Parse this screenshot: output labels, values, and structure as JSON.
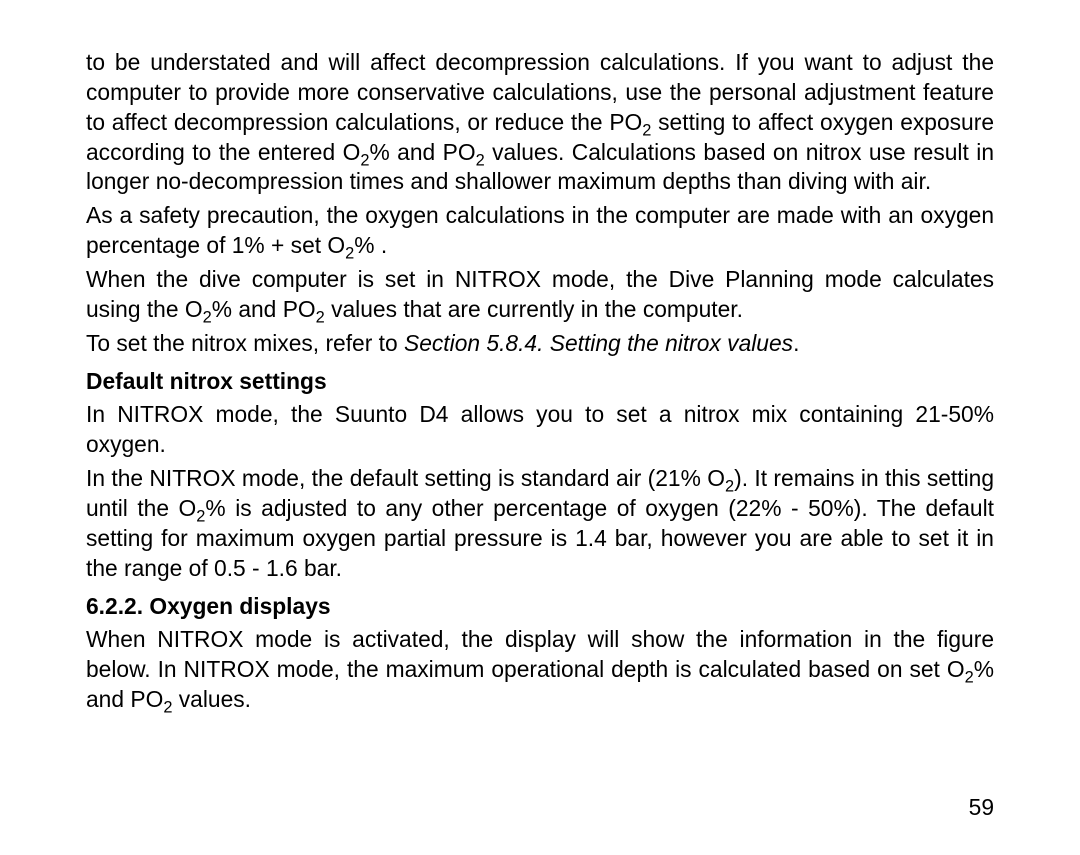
{
  "paragraphs": {
    "p1a": "to be understated and will affect decompression calculations. If you want to adjust the computer to provide more conservative calculations, use the personal adjustment feature to affect decompression calculations, or reduce the PO",
    "p1b": " setting to affect oxygen exposure according to the entered O",
    "p1c": "% and PO",
    "p1d": " values. Calculations based on nitrox use result in longer no-decompression times and shallower maximum depths than diving with air.",
    "p2a": "As a safety precaution, the oxygen calculations in the computer are made with an oxygen percentage of 1% + set O",
    "p2b": "% .",
    "p3a": "When the dive computer is set in NITROX mode, the Dive Planning mode calculates using the O",
    "p3b": "% and PO",
    "p3c": " values that are currently in the computer.",
    "p4a": "To set the nitrox mixes, refer to ",
    "p4b": "Section 5.8.4. Setting the nitrox values",
    "p4c": ".",
    "h1": "Default nitrox settings",
    "p5": "In NITROX mode, the Suunto D4 allows you to set a nitrox mix containing 21-50% oxygen.",
    "p6a": "In the NITROX mode, the default setting is standard air (21% O",
    "p6b": "). It remains in this setting until the O",
    "p6c": "% is adjusted to any other percentage of oxygen (22% - 50%). The default setting for maximum oxygen partial pressure is 1.4 bar, however you are able to set it in the range of 0.5 - 1.6 bar.",
    "h2": "6.2.2. Oxygen displays",
    "p7a": "When NITROX mode is activated, the display will show the information in the figure below. In NITROX mode, the maximum operational depth is calculated based on set O",
    "p7b": "% and PO",
    "p7c": " values."
  },
  "sub2": "2",
  "page_number": "59"
}
